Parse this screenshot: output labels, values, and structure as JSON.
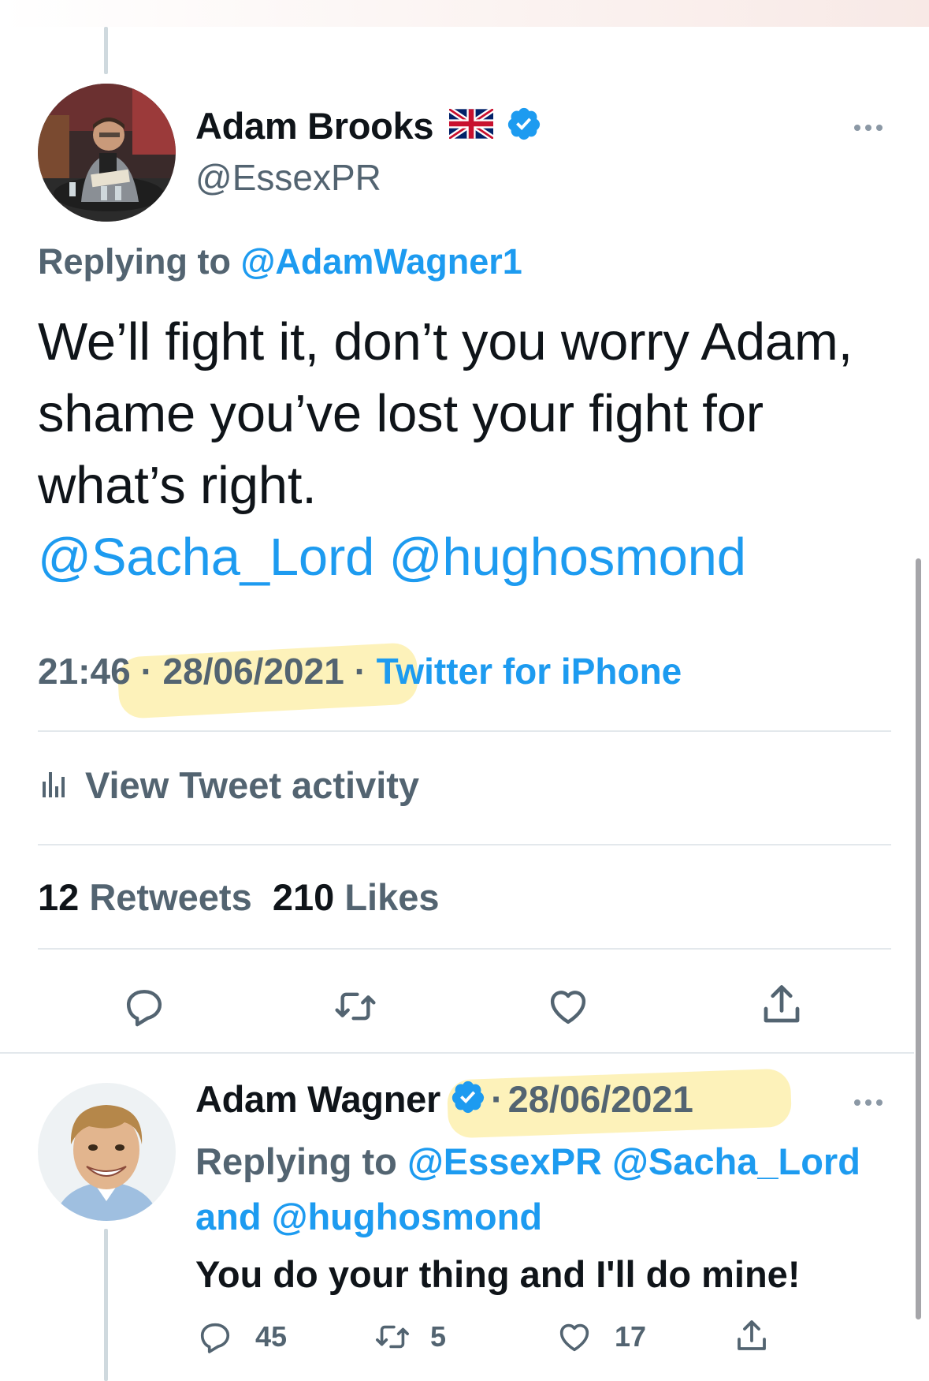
{
  "main_tweet": {
    "author_name": "Adam Brooks",
    "handle": "@EssexPR",
    "flag_icon": "uk-flag-icon",
    "replying_prefix": "Replying to",
    "replying_to": "@AdamWagner1",
    "text": "We’ll fight it, don’t you worry Adam, shame you’ve lost your fight for what’s right.",
    "mentions": "@Sacha_Lord @hughosmond",
    "time": "21:46",
    "separator": "·",
    "date": "28/06/2021",
    "source": "Twitter for iPhone",
    "activity_label": "View Tweet activity",
    "retweets_count": "12",
    "retweets_label": "Retweets",
    "likes_count": "210",
    "likes_label": "Likes"
  },
  "reply_tweet": {
    "author_name": "Adam Wagner",
    "separator": "·",
    "date": "28/06/2021",
    "replying_prefix": "Replying to",
    "replying_to_1": "@EssexPR",
    "replying_to_2": "@Sacha_Lord",
    "and_word": "and",
    "replying_to_3": "@hughosmond",
    "text": "You do your thing and I'll do mine!",
    "reply_count": "45",
    "retweet_count": "5",
    "like_count": "17"
  },
  "colors": {
    "link": "#1d9bf0",
    "secondary_text": "#536471",
    "primary_text": "#0f1419",
    "highlight": "#fce882"
  }
}
